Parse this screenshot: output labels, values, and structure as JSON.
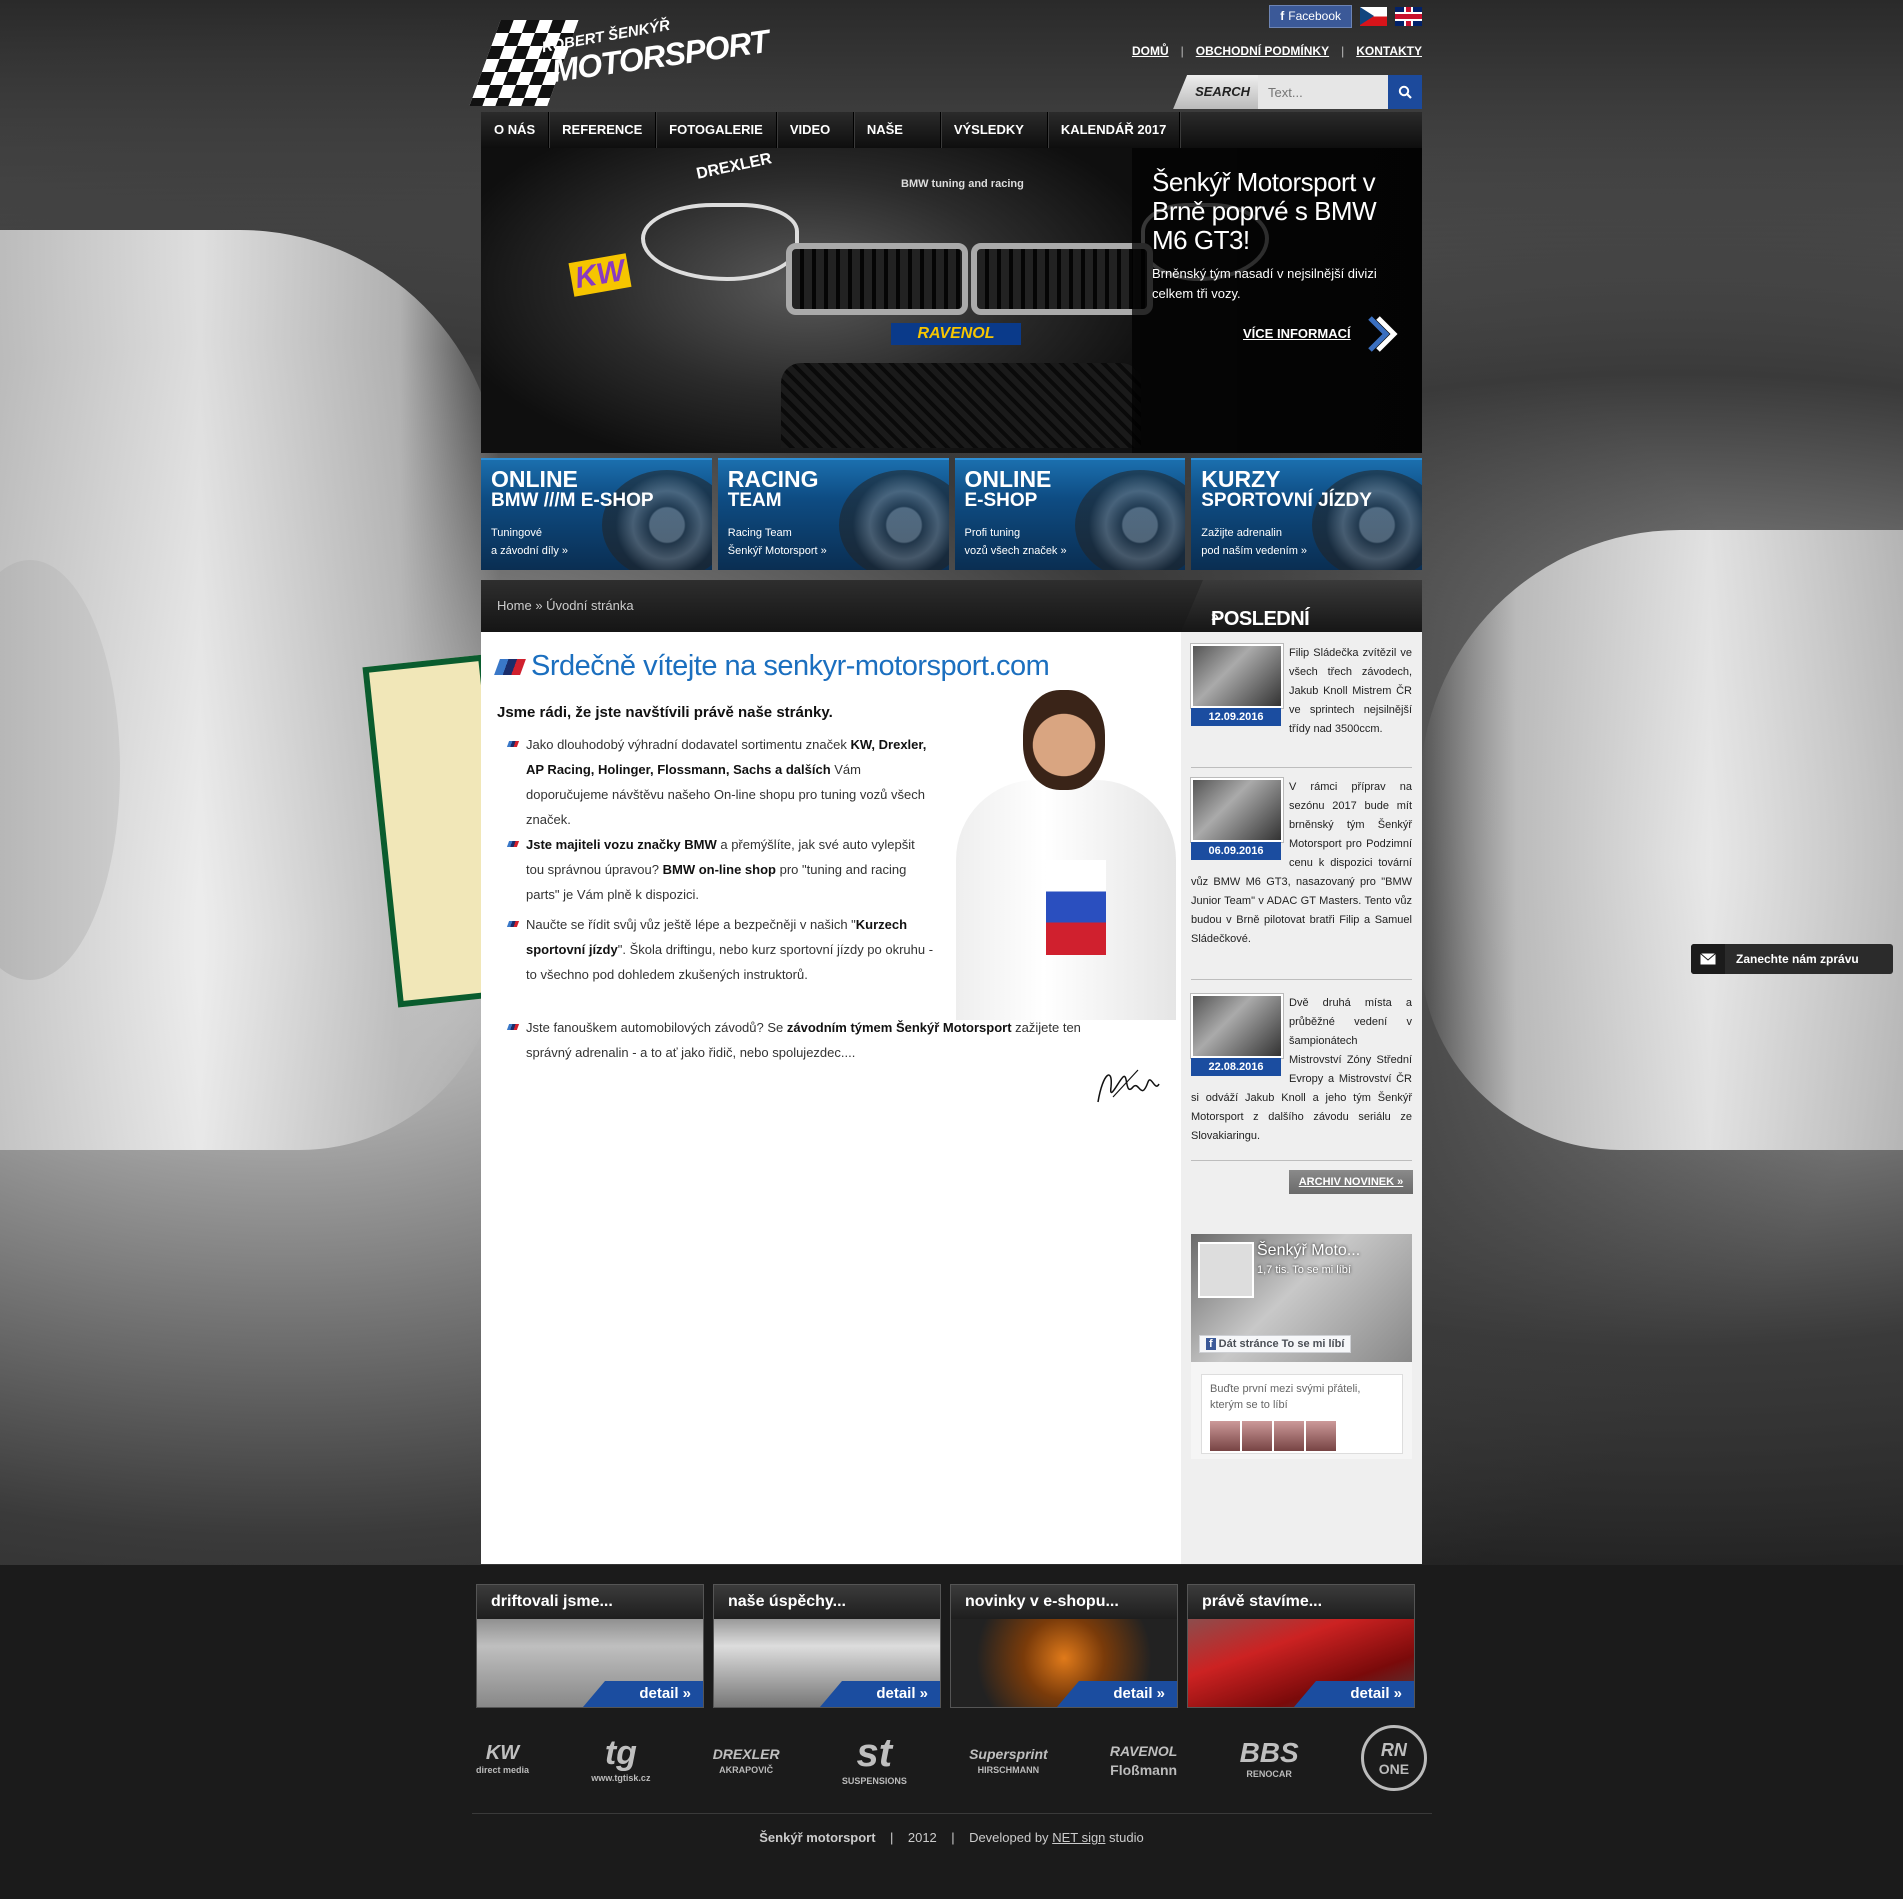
{
  "header": {
    "logo_line1": "ROBERT ŠENKÝŘ",
    "logo_line2": "MOTORSPORT",
    "facebook_label": "Facebook",
    "links": [
      "DOMŮ",
      "OBCHODNÍ PODMÍNKY",
      "KONTAKTY"
    ],
    "search_label": "SEARCH",
    "search_placeholder": "Text..."
  },
  "nav": [
    "O NÁS",
    "REFERENCE",
    "FOTOGALERIE",
    "VIDEO",
    "NAŠE AUTA",
    "VÝSLEDKY",
    "KALENDÁŘ 2017"
  ],
  "banner": {
    "title": "Šenkýř Motorsport v Brně poprvé s BMW M6 GT3!",
    "text": "Brněnský tým nasadí v nejsilnější divizi celkem tři vozy.",
    "more": "VÍCE INFORMACÍ",
    "car_labels": {
      "drexler": "DREXLER",
      "bmw_text": "BMW tuning and racing",
      "ravenol": "RAVENOL",
      "kw": "KW"
    }
  },
  "tiles": [
    {
      "t1": "ONLINE",
      "t2": "BMW ///M E-SHOP",
      "d1": "Tuningové",
      "d2": "a závodní díly »"
    },
    {
      "t1": "RACING",
      "t2": "TEAM",
      "d1": "Racing Team",
      "d2": "Šenkýř Motorsport »"
    },
    {
      "t1": "ONLINE",
      "t2": "E-SHOP",
      "d1": "Profi tuning",
      "d2": "vozů všech značek »"
    },
    {
      "t1": "KURZY",
      "t2": "SPORTOVNÍ JÍZDY",
      "d1": "Zažijte adrenalin",
      "d2": "pod naším vedením »"
    }
  ],
  "breadcrumb": {
    "home": "Home",
    "sep": "»",
    "current": "Úvodní stránka"
  },
  "news_header": "POSLEDNÍ NOVINKY",
  "news_header_arrow": "»",
  "content": {
    "title": "Srdečně vítejte na senkyr-motorsport.com",
    "lead": "Jsme rádi, že jste navštívili právě naše stránky.",
    "p1a": "Jako dlouhodobý výhradní dodavatel sortimentu značek ",
    "p1b": "KW, Drexler, AP Racing, Holinger, Flossmann, Sachs a dalších",
    "p1c": " Vám doporučujeme návštěvu našeho On-line shopu pro tuning vozů všech značek.",
    "p2a": "Jste majiteli vozu značky BMW",
    "p2b": " a přemýšlíte, jak své auto vylepšit tou správnou úpravou? ",
    "p2c": "BMW on-line shop",
    "p2d": " pro \"tuning and racing parts\" je Vám plně k dispozici.",
    "p3a": "Naučte se řídit svůj vůz ještě lépe a bezpečněji v našich \"",
    "p3b": "Kurzech sportovní jízdy",
    "p3c": "\". Škola driftingu, nebo kurz sportovní jízdy po okruhu - to všechno pod dohledem zkušených instruktorů.",
    "p4a": "Jste fanouškem automobilových závodů? Se ",
    "p4b": "závodním týmem Šenkýř Motorsport",
    "p4c": " zažijete ten správný adrenalin - a to ať jako řidič, nebo spolujezdec...."
  },
  "news": [
    {
      "date": "12.09.2016",
      "text": "Filip Sládečka zvítězil ve všech třech závodech, Jakub Knoll Mistrem ČR ve sprintech nejsilnější třídy nad 3500ccm."
    },
    {
      "date": "06.09.2016",
      "text": "V rámci příprav na sezónu 2017 bude mít brněnský tým Šenkýř Motorsport pro Podzimní cenu k dispozici tovární vůz BMW M6 GT3, nasazovaný pro \"BMW Junior Team\" v ADAC GT Masters. Tento vůz budou v Brně pilotovat bratři Filip a Samuel Sládečkové."
    },
    {
      "date": "22.08.2016",
      "text": "Dvě druhá místa a průběžné vedení v šampionátech Mistrovství Zóny Střední Evropy a Mistrovství ČR si odváží Jakub Knoll a jeho tým Šenkýř Motorsport z dalšího závodu seriálu ze Slovakiaringu."
    }
  ],
  "archive": "ARCHIV NOVINEK »",
  "facebook_box": {
    "name": "Šenkýř Moto...",
    "likes": "1,7 tis. To se mi líbí",
    "like_button": "Dát stránce To se mi líbí",
    "friends_text": "Buďte první mezi svými přáteli, kterým se to líbí"
  },
  "message_tab": "Zanechte nám zprávu",
  "footer_tiles": [
    {
      "title": "driftovali jsme...",
      "detail": "detail »"
    },
    {
      "title": "naše úspěchy...",
      "detail": "detail »"
    },
    {
      "title": "novinky v e-shopu...",
      "detail": "detail »"
    },
    {
      "title": "právě stavíme...",
      "detail": "detail »"
    }
  ],
  "sponsors": [
    {
      "name": "KW",
      "sub": "direct media"
    },
    {
      "name": "tg",
      "sub": "www.tgtisk.cz"
    },
    {
      "name": "DREXLER",
      "sub": "AKRAPOVIČ"
    },
    {
      "name": "st",
      "sub": "SUSPENSIONS"
    },
    {
      "name": "Supersprint",
      "sub": "HIRSCHMANN"
    },
    {
      "name": "RAVENOL",
      "sub": "Floßmann"
    },
    {
      "name": "BBS",
      "sub": "RENOCAR"
    },
    {
      "name": "RN",
      "sub": "ONE"
    }
  ],
  "copyright": {
    "name": "Šenkýř motorsport",
    "year": "2012",
    "dev_prefix": "Developed by ",
    "dev_link": "NET sign",
    "dev_suffix": " studio"
  },
  "colors": {
    "accent_blue": "#1b4da0",
    "title_blue": "#1b6fbf",
    "fb_blue": "#3b5998"
  }
}
